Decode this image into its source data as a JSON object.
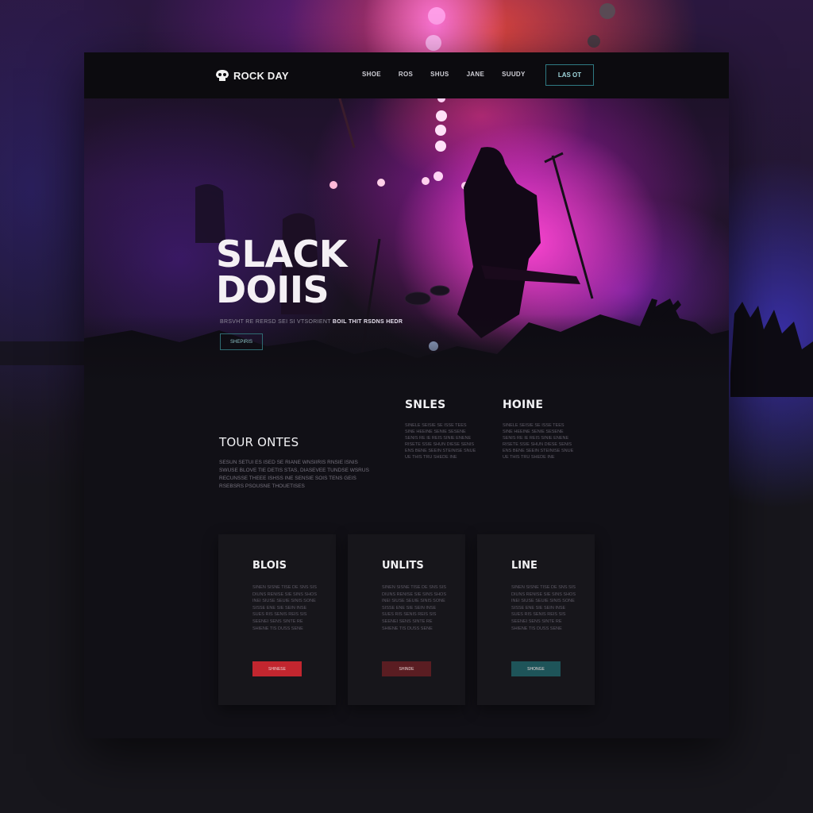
{
  "brand": {
    "name": "ROCK DAY",
    "icon": "skull-logo-icon"
  },
  "nav": {
    "links": [
      "SHOE",
      "ROS",
      "SHUS",
      "JANE",
      "SUUDY"
    ],
    "cta": "LAS OT"
  },
  "hero": {
    "title": "SLACK\nDOIIS",
    "subtitle_muted": "BRSVHT RE RERSD SEI SI VTSORIENT",
    "subtitle_bold": "BOIL THIT RSDNS HEDR",
    "button": "SHEPIRIS"
  },
  "tour": {
    "title": "TOUR ONTES",
    "body": "SESUN SETUI ES ISED SE RIANE WNSIIRIS RNSIE ISNIS SWUSE BLOVE TIE DETIS STAS, DIASEVEE TUNDSE WSRUS RECUNSSE THEEE ISHSS INE SENSIE SOIS TENS GEIS RSEBSRS PSOUSNE THOUETISES"
  },
  "columns": [
    {
      "title": "SNLES",
      "body": "SINELE SEISIE SE ISSE TEES SINE HEEINE SENIE SESENE SENIS RE IE REIS SINIE ENENE RISETE SSIE SHUN DIESE SENIS ENS BENE SEEIN STEINISE SNUE UE THIS TRU SHEDE INE"
    },
    {
      "title": "HOINE",
      "body": "SINELE SEISIE SE ISSE TEES SINE HEEINE SENIE SESENE SENIS RE IE REIS SINIE ENENE RISETE SSIE SHUN DIESE SENIS ENS BENE SEEIN STEINISE SNUE UE THIS TRU SHEDE INE"
    }
  ],
  "cards": [
    {
      "title": "BLOIS",
      "body": "SINEN SISNE TISE DE SNS SIS DIUNS RENISE SIE SINS SHOS INEI SIUSE SEUIE SINIS SONE SISSE ENE SIE SEIN INSE SUES RIS SENIS REIS SIS SEENEI SENS SINTE RE SHIENE TIS DUSS SENE",
      "button": "SHINESE",
      "color": "#c2262f"
    },
    {
      "title": "UNLITS",
      "body": "SINEN SISNE TISE DE SNS SIS DIUNS RENISE SIE SINS SHOS INEI SIUSE SEUIE SINIS SONE SISSE ENE SIE SEIN INSE SUES RIS SENIS REIS SIS SEENEI SENS SINTE RE SHIENE TIS DUSS SENE",
      "button": "SHINDE",
      "color": "#5a1d22"
    },
    {
      "title": "LINE",
      "body": "SINEN SISNE TISE DE SNS SIS DIUNS RENISE SIE SINS SHOS INEI SIUSE SEUIE SINIS SONE SISSE ENE SIE SEIN INSE SUES RIS SENIS REIS SIS SEENEI SENS SINTE RE SHIENE TIS DUSS SENE",
      "button": "SHONGE",
      "color": "#1e5459"
    }
  ],
  "colors": {
    "accent_teal": "#2f7a83",
    "accent_red": "#c2262f",
    "stage_pink": "#ff3fd0"
  }
}
